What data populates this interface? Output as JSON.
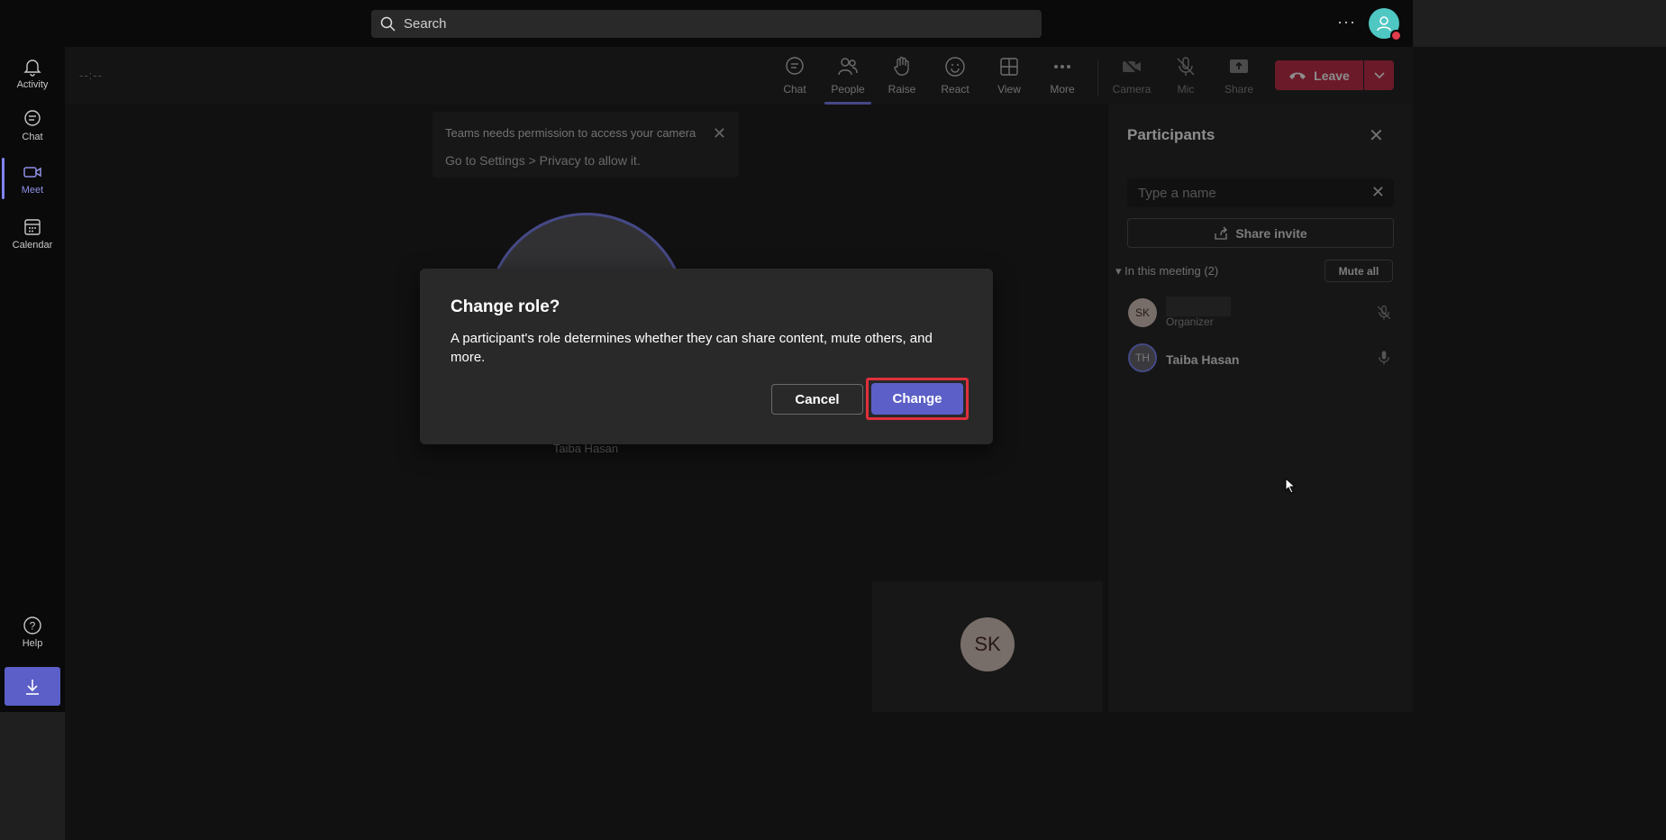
{
  "search": {
    "placeholder": "Search"
  },
  "rail": {
    "items": [
      {
        "label": "Activity",
        "icon": "bell-icon"
      },
      {
        "label": "Chat",
        "icon": "chat-icon"
      },
      {
        "label": "Meet",
        "icon": "video-icon",
        "active": true
      },
      {
        "label": "Calendar",
        "icon": "calendar-icon"
      }
    ],
    "help": "Help",
    "download_icon": "download-icon"
  },
  "meeting": {
    "timer": "--:--",
    "toolbar": [
      {
        "label": "Chat",
        "icon": "chat-icon"
      },
      {
        "label": "People",
        "icon": "people-icon",
        "active": true
      },
      {
        "label": "Raise",
        "icon": "hand-icon"
      },
      {
        "label": "React",
        "icon": "smile-icon"
      },
      {
        "label": "View",
        "icon": "grid-icon"
      },
      {
        "label": "More",
        "icon": "more-icon"
      },
      {
        "label": "Camera",
        "icon": "camera-off-icon"
      },
      {
        "label": "Mic",
        "icon": "mic-off-icon"
      },
      {
        "label": "Share",
        "icon": "share-icon"
      }
    ],
    "leave_label": "Leave",
    "notice": {
      "line1": "Teams needs permission to access your camera",
      "line2": "Go to Settings > Privacy to allow it."
    },
    "stage_name": "Taiba Hasan",
    "tile_initials": "SK"
  },
  "participants": {
    "title": "Participants",
    "search_placeholder": "Type a name",
    "share_invite": "Share invite",
    "section": "In this meeting (2)",
    "mute_all": "Mute all",
    "people": [
      {
        "initials": "SK",
        "name": "",
        "role": "Organizer"
      },
      {
        "initials": "TH",
        "name": "Taiba Hasan",
        "role": ""
      }
    ]
  },
  "dialog": {
    "title": "Change role?",
    "body": "A participant's role determines whether they can share content, mute others, and more.",
    "cancel": "Cancel",
    "confirm": "Change"
  },
  "colors": {
    "accent": "#5b5fc7",
    "leave": "#c4314b",
    "highlight": "#e0303b"
  }
}
